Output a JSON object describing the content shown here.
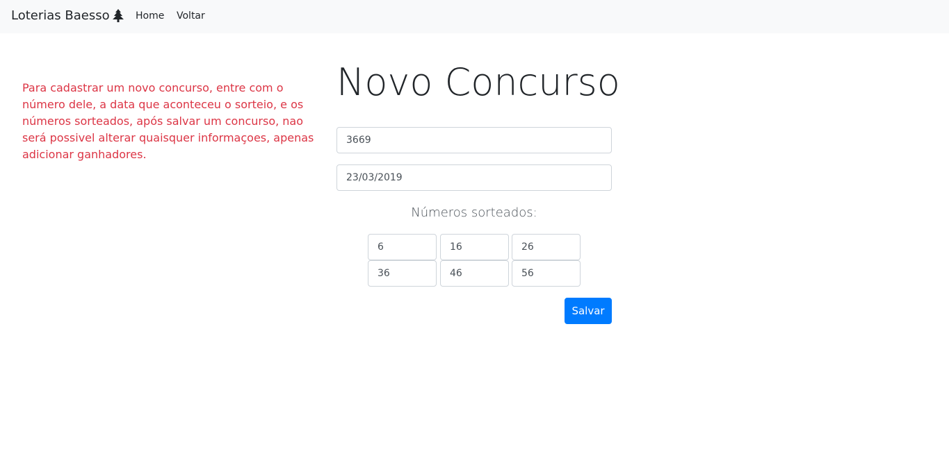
{
  "navbar": {
    "brand": "Loterias Baesso",
    "brand_icon": "tree-icon",
    "links": [
      {
        "label": "Home"
      },
      {
        "label": "Voltar"
      }
    ],
    "background": "#f8f9fa"
  },
  "info": {
    "text": "Para cadastrar um novo concurso, entre com o número dele, a data que aconteceu o sorteio, e os números sorteados, após salvar um concurso, nao será possivel alterar quaisquer informaçoes, apenas adicionar ganhadores.",
    "color": "#dc3545"
  },
  "form": {
    "title": "Novo Concurso",
    "contest_number": "3669",
    "date": "23/03/2019",
    "numbers_label": "Números sorteados:",
    "numbers": [
      "6",
      "16",
      "26",
      "36",
      "46",
      "56"
    ],
    "save_label": "Salvar",
    "accent": "#007bff"
  }
}
